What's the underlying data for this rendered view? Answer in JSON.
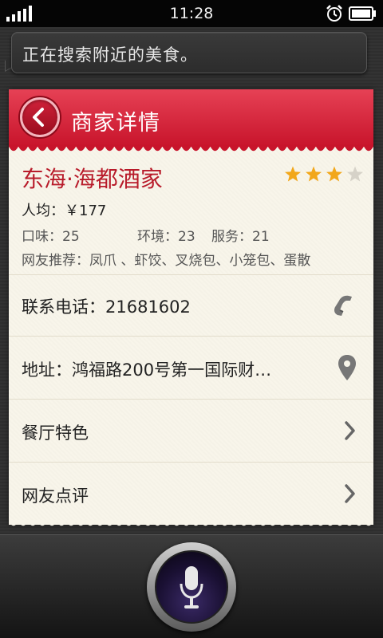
{
  "status_bar": {
    "time": "11:28"
  },
  "assistant": {
    "speech_text": "正在搜索附近的美食。"
  },
  "header": {
    "title": "商家详情",
    "accent_color": "#d21f36"
  },
  "restaurant": {
    "name": "东海·海都酒家",
    "rating_stars": 3,
    "rating_max": 5,
    "avg_price": "人均：￥177",
    "scores": [
      "口味：25",
      "环境：23",
      "服务：21"
    ],
    "recommend": "网友推荐：凤爪 、虾饺、叉烧包、小笼包、蛋散"
  },
  "rows": {
    "phone": "联系电话：21681602",
    "address": "地址：鸿福路200号第一国际财…",
    "features": "餐厅特色",
    "reviews": "网友点评"
  },
  "icons": {
    "back": "chevron-left-icon",
    "phone": "phone-icon",
    "location": "map-pin-icon",
    "chevron": "chevron-right-icon",
    "mic": "microphone-icon"
  }
}
